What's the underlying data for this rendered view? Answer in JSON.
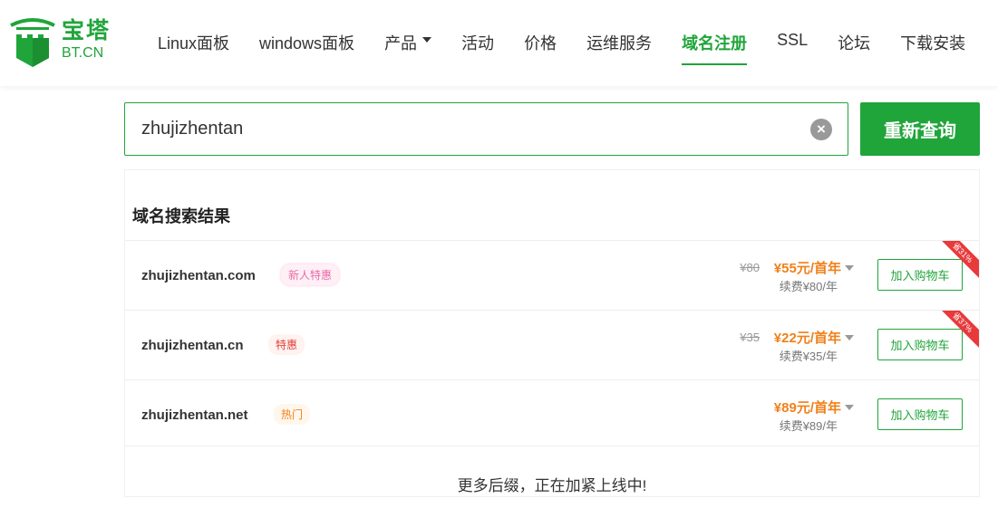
{
  "logo": {
    "cn": "宝塔",
    "en": "BT.CN"
  },
  "nav": [
    "Linux面板",
    "windows面板",
    "产品",
    "活动",
    "价格",
    "运维服务",
    "域名注册",
    "SSL",
    "论坛",
    "下载安装"
  ],
  "search": {
    "value": "zhujizhentan",
    "button": "重新查询"
  },
  "results": {
    "title": "域名搜索结果",
    "items": [
      {
        "domain": "zhujizhentan.com",
        "tag": "新人特惠",
        "old": "¥80",
        "price": "¥55元/首年",
        "renew": "续费¥80/年",
        "ribbon": "省31%",
        "cart": "加入购物车"
      },
      {
        "domain": "zhujizhentan.cn",
        "tag": "特惠",
        "old": "¥35",
        "price": "¥22元/首年",
        "renew": "续费¥35/年",
        "ribbon": "省37%",
        "cart": "加入购物车"
      },
      {
        "domain": "zhujizhentan.net",
        "tag": "热门",
        "price": "¥89元/首年",
        "renew": "续费¥89/年",
        "cart": "加入购物车"
      }
    ],
    "more": "更多后缀，正在加紧上线中!"
  }
}
